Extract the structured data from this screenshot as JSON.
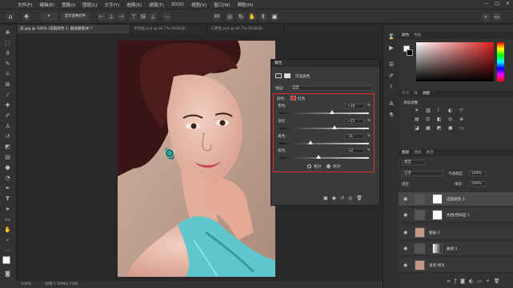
{
  "app": {
    "logo": "Ps",
    "window_controls": [
      "—",
      "□",
      "✕"
    ]
  },
  "menu": [
    "文件(F)",
    "编辑(E)",
    "图像(I)",
    "图层(L)",
    "文字(Y)",
    "选择(S)",
    "滤镜(T)",
    "3D(D)",
    "视图(V)",
    "窗口(W)",
    "帮助(H)"
  ],
  "options_bar": {
    "sample_label": "显示变换控件"
  },
  "tabs": [
    {
      "label": "前.jpg @ 100% (选取颜色 1, 图层蒙版/8) *",
      "active": true
    },
    {
      "label": "手机图.psd @ 66.7% (RGB/8)",
      "active": false
    },
    {
      "label": "三原色.psd @ 66.7% (RGB/8)",
      "active": false
    }
  ],
  "status": {
    "zoom": "100%",
    "doc": "文档:1.76M/3.74M"
  },
  "properties": {
    "title": "属性",
    "header_label": "可选颜色",
    "preset_label": "预设:",
    "preset_value": "自定",
    "colors_label": "颜色:",
    "color_value": "红色",
    "color_swatch": "#e02020",
    "sliders": [
      {
        "label": "青色:",
        "value": "+18",
        "percent": "%",
        "fraction": 0.59
      },
      {
        "label": "洋红:",
        "value": "+25",
        "percent": "%",
        "fraction": 0.62
      },
      {
        "label": "黄色:",
        "value": "-31",
        "percent": "%",
        "fraction": 0.35
      },
      {
        "label": "黑色:",
        "value": "-12",
        "percent": "%",
        "fraction": 0.44
      }
    ],
    "mode_options": [
      "相对",
      "绝对"
    ],
    "mode_selected": "绝对"
  },
  "right_panels": {
    "color_tabs": [
      "颜色",
      "色板"
    ],
    "adjust_tabs": [
      "学习",
      "库",
      "调整"
    ],
    "adjust_title": "添加调整",
    "layers_tabs": [
      "图层",
      "通道",
      "路径"
    ],
    "kind_label": "类型",
    "blend_mode": "正常",
    "opacity_label": "不透明度:",
    "opacity_value": "100%",
    "lock_label": "锁定:",
    "fill_label": "填充:",
    "fill_value": "100%",
    "layers": [
      {
        "name": "选取颜色 1",
        "selected": true
      },
      {
        "name": "色相/饱和度 1",
        "selected": false
      },
      {
        "name": "图层 2",
        "selected": false
      },
      {
        "name": "曲线 1",
        "selected": false
      },
      {
        "name": "背景 拷贝",
        "selected": false
      }
    ]
  },
  "colors": {
    "accent_red": "#e12b2b",
    "foreground": "#ffffff",
    "background": "#000000"
  }
}
